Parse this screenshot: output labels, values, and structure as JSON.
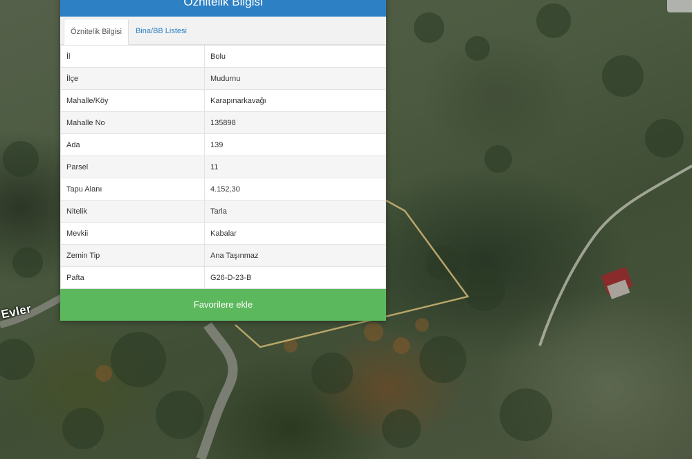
{
  "panel": {
    "title": "Öznitelik Bilgisi",
    "tabs": [
      {
        "label": "Öznitelik Bilgisi",
        "active": true
      },
      {
        "label": "Bina/BB Listesi",
        "active": false
      }
    ],
    "rows": [
      {
        "key": "İl",
        "value": "Bolu"
      },
      {
        "key": "İlçe",
        "value": "Mudurnu"
      },
      {
        "key": "Mahalle/Köy",
        "value": "Karapınarkavağı"
      },
      {
        "key": "Mahalle No",
        "value": "135898"
      },
      {
        "key": "Ada",
        "value": "139"
      },
      {
        "key": "Parsel",
        "value": "11"
      },
      {
        "key": "Tapu Alanı",
        "value": "4.152,30"
      },
      {
        "key": "Nitelik",
        "value": "Tarla"
      },
      {
        "key": "Mevkii",
        "value": "Kabalar"
      },
      {
        "key": "Zemin Tip",
        "value": "Ana Taşınmaz"
      },
      {
        "key": "Pafta",
        "value": "G26-D-23-B"
      }
    ],
    "favorite_button": "Favorilere ekle"
  },
  "map": {
    "place_label": "Evler"
  },
  "colors": {
    "header": "#2d80c4",
    "button": "#5cb85c",
    "parcel_outline": "#b8a66a"
  }
}
